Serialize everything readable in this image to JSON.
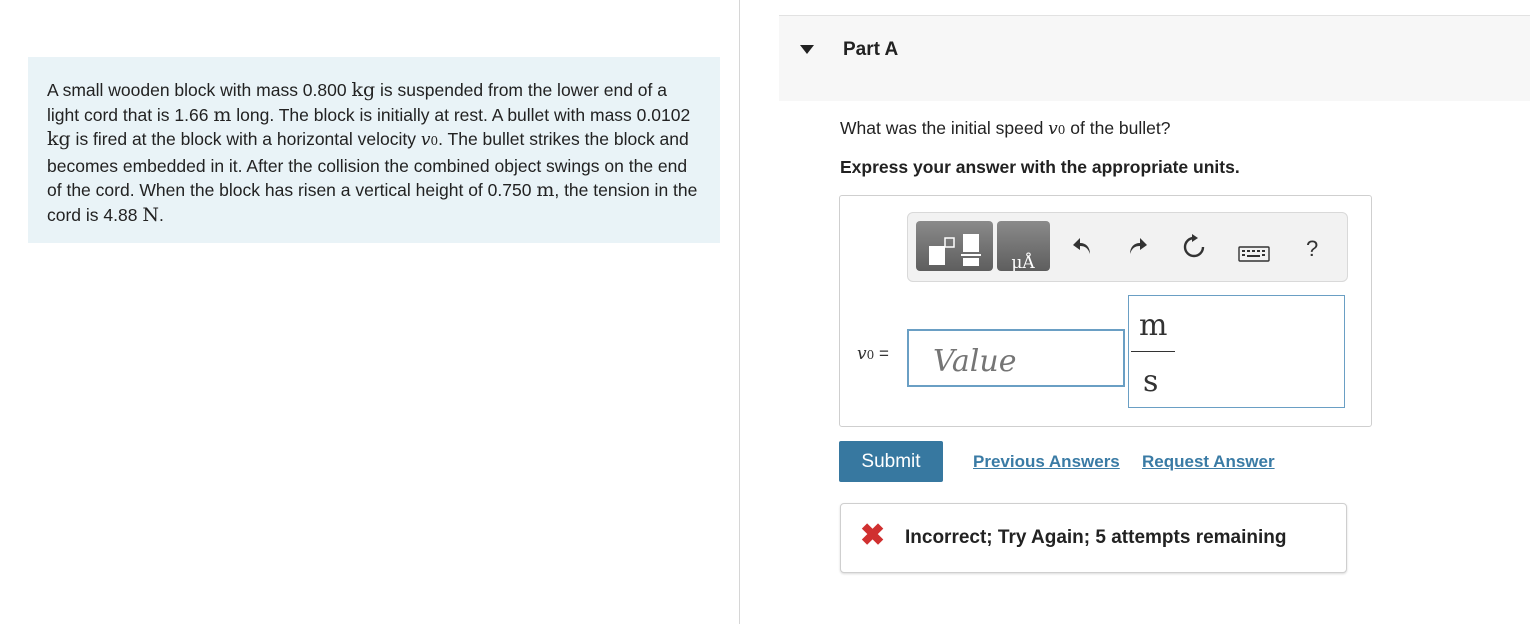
{
  "problem": {
    "seg1": "A small wooden block with mass 0.800 ",
    "u_kg": "kg",
    "seg2": " is suspended from the lower end of a light cord that is 1.66 ",
    "u_m": "m",
    "seg3": " long. The block is initially at rest. A bullet with mass 0.0102 ",
    "u_kg2": "kg",
    "seg4": " is fired at the block with a horizontal velocity ",
    "v": "v",
    "v_sub": "0",
    "seg5": ". The bullet strikes the block and becomes embedded in it. After the collision the combined object swings on the end of the cord. When the block has risen a vertical height of 0.750 ",
    "u_m2": "m",
    "seg6": ", the tension in the cord is 4.88 ",
    "u_N": "N",
    "seg7": "."
  },
  "part": {
    "title": "Part A"
  },
  "question": {
    "pre": "What was the initial speed ",
    "v": "v",
    "v_sub": "0",
    "post": " of the bullet?",
    "instruction": "Express your answer with the appropriate units."
  },
  "toolbar": {
    "units_button_text": "μÅ",
    "help": "?",
    "icons": [
      "templates-icon",
      "units-icon",
      "undo-icon",
      "redo-icon",
      "reset-icon",
      "keyboard-icon",
      "help-icon"
    ]
  },
  "answer": {
    "var": "v",
    "var_sub": "0",
    "equals": " =",
    "placeholder": "Value",
    "unit_numerator": "m",
    "unit_denominator": "s"
  },
  "actions": {
    "submit": "Submit",
    "previous_answers": "Previous Answers",
    "request_answer": "Request Answer"
  },
  "feedback": {
    "text": "Incorrect; Try Again; 5 attempts remaining",
    "color": "#d03030"
  },
  "colors": {
    "accent": "#3778a0",
    "link": "#3a7ba5",
    "problem_bg": "#e9f3f7",
    "input_border": "#6a9fc4"
  }
}
